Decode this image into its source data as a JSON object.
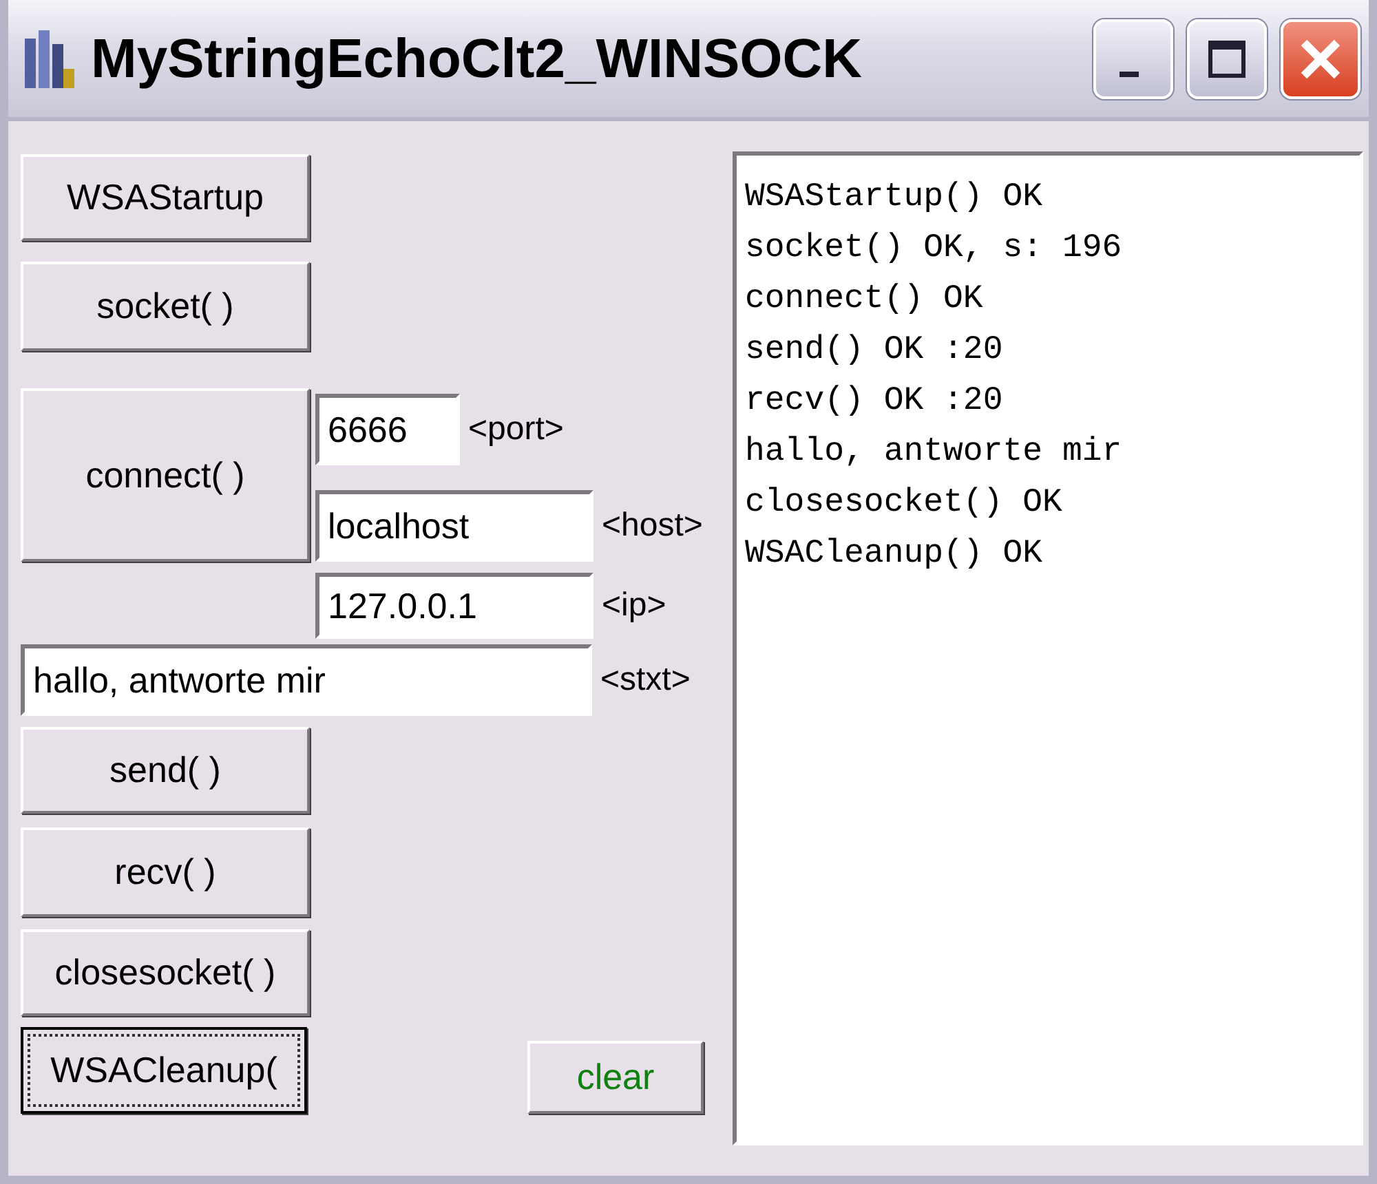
{
  "window": {
    "title": "MyStringEchoClt2_WINSOCK"
  },
  "buttons": [
    {
      "kind": "startup",
      "label": "WSAStartup",
      "focused": false
    },
    {
      "kind": "socket",
      "label": "socket( )",
      "focused": false
    },
    {
      "kind": "connect",
      "label": "connect( )",
      "focused": false
    },
    {
      "kind": "send",
      "label": "send( )",
      "focused": false
    },
    {
      "kind": "recv",
      "label": "recv( )",
      "focused": false
    },
    {
      "kind": "close",
      "label": "closesocket( )",
      "focused": false
    },
    {
      "kind": "cleanup",
      "label": "WSACleanup(",
      "focused": true
    },
    {
      "kind": "clear",
      "label": "clear",
      "focused": false
    }
  ],
  "fields": [
    {
      "kind": "port",
      "value": "6666"
    },
    {
      "kind": "host",
      "value": "localhost"
    },
    {
      "kind": "ip",
      "value": "127.0.0.1"
    },
    {
      "kind": "stxt",
      "value": "hallo, antworte mir"
    }
  ],
  "field_labels": [
    "<port>",
    "<host>",
    "<ip>",
    "<stxt>"
  ],
  "log": [
    "WSAStartup() OK",
    "socket() OK, s: 196",
    "connect() OK",
    "send() OK :20",
    "recv() OK :20",
    "hallo, antworte mir",
    "closesocket() OK",
    "WSACleanup() OK"
  ]
}
